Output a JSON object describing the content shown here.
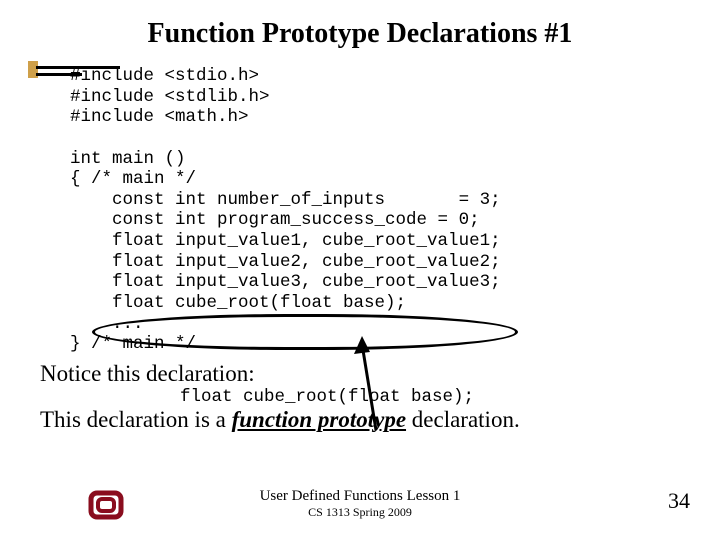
{
  "title": "Function Prototype Declarations #1",
  "code_block": "#include <stdio.h>\n#include <stdlib.h>\n#include <math.h>\n\nint main ()\n{ /* main */\n    const int number_of_inputs       = 3;\n    const int program_success_code = 0;\n    float input_value1, cube_root_value1;\n    float input_value2, cube_root_value2;\n    float input_value3, cube_root_value3;\n    float cube_root(float base);\n    ...\n} /* main */",
  "notice_label": "Notice this declaration:",
  "notice_code": "float cube_root(float base);",
  "conclusion_pre": "This declaration is a ",
  "conclusion_term": "function prototype",
  "conclusion_post": " declaration.",
  "footer_line1": "User Defined Functions Lesson 1",
  "footer_line2": "CS 1313 Spring 2009",
  "page_number": "34"
}
